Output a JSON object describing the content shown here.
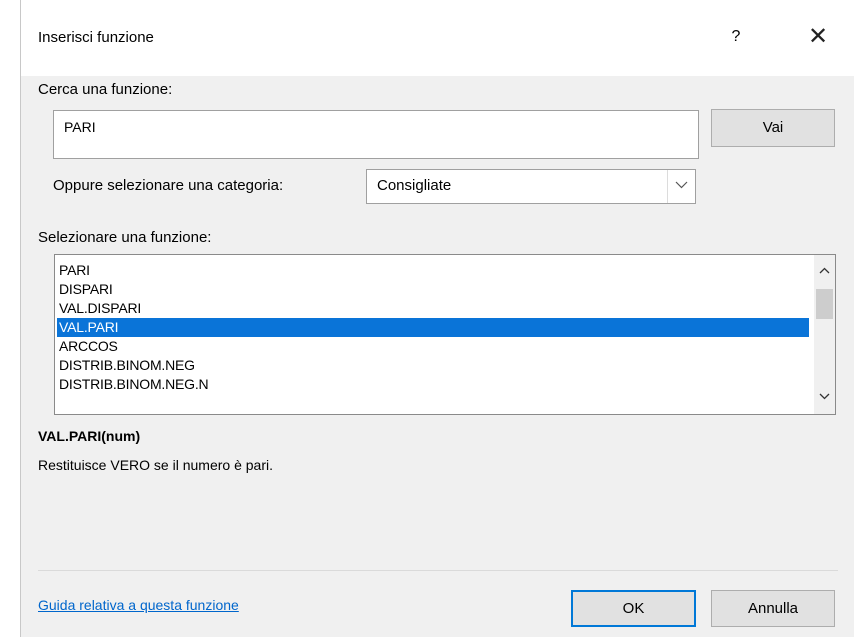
{
  "dialog": {
    "title": "Inserisci funzione",
    "help_label": "?",
    "close_label": "✕"
  },
  "search": {
    "label": "Cerca una funzione:",
    "value": "PARI",
    "go_label": "Vai"
  },
  "category": {
    "label": "Oppure selezionare una categoria:",
    "selected": "Consigliate"
  },
  "function_list": {
    "label": "Selezionare una funzione:",
    "items": [
      {
        "label": "PARI",
        "selected": false
      },
      {
        "label": "DISPARI",
        "selected": false
      },
      {
        "label": "VAL.DISPARI",
        "selected": false
      },
      {
        "label": "VAL.PARI",
        "selected": true
      },
      {
        "label": "ARCCOS",
        "selected": false
      },
      {
        "label": "DISTRIB.BINOM.NEG",
        "selected": false
      },
      {
        "label": "DISTRIB.BINOM.NEG.N",
        "selected": false
      }
    ]
  },
  "details": {
    "signature": "VAL.PARI(num)",
    "description": "Restituisce VERO se il numero è pari."
  },
  "footer": {
    "help_link": "Guida relativa a questa funzione",
    "ok_label": "OK",
    "cancel_label": "Annulla"
  },
  "colors": {
    "selection": "#0a74d8",
    "link": "#0066cc",
    "default_button_border": "#0078d7"
  }
}
